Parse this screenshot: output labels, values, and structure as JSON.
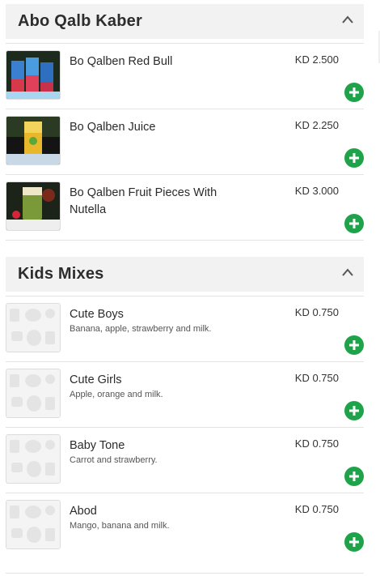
{
  "sections": [
    {
      "title": "Abo Qalb Kaber",
      "icon": "chevron-up-icon",
      "items": [
        {
          "name": "Bo Qalben Red Bull",
          "description": "",
          "price": "KD 2.500",
          "image": "photo"
        },
        {
          "name": "Bo Qalben Juice",
          "description": "",
          "price": "KD 2.250",
          "image": "photo"
        },
        {
          "name": "Bo Qalben Fruit Pieces With Nutella",
          "description": "",
          "price": "KD 3.000",
          "image": "photo"
        }
      ]
    },
    {
      "title": "Kids Mixes",
      "icon": "chevron-up-icon",
      "items": [
        {
          "name": "Cute Boys",
          "description": "Banana, apple, strawberry and milk.",
          "price": "KD 0.750",
          "image": "placeholder"
        },
        {
          "name": "Cute Girls",
          "description": "Apple, orange and milk.",
          "price": "KD 0.750",
          "image": "placeholder"
        },
        {
          "name": "Baby Tone",
          "description": "Carrot and strawberry.",
          "price": "KD 0.750",
          "image": "placeholder"
        },
        {
          "name": "Abod",
          "description": "Mango, banana and milk.",
          "price": "KD 0.750",
          "image": "placeholder"
        }
      ]
    }
  ],
  "colors": {
    "add_button": "#1fa34a",
    "section_header_bg": "#f2f2f2",
    "divider": "#e3e3e3"
  }
}
